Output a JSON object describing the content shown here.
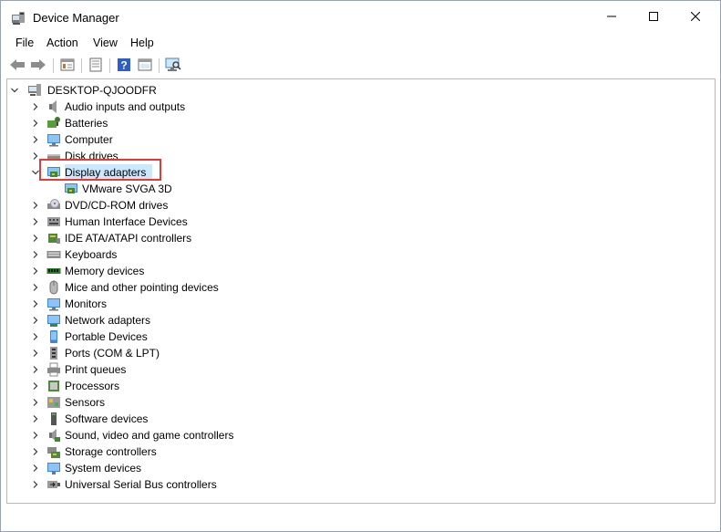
{
  "window": {
    "title": "Device Manager",
    "icon": "device-manager-icon"
  },
  "menu": [
    {
      "label": "File",
      "name": "menu-file"
    },
    {
      "label": "Action",
      "name": "menu-action"
    },
    {
      "label": "View",
      "name": "menu-view"
    },
    {
      "label": "Help",
      "name": "menu-help"
    }
  ],
  "toolbar": [
    "back-arrow-icon",
    "forward-arrow-icon",
    "console-tree-icon",
    "properties-icon",
    "help-icon",
    "view-icon",
    "scan-hardware-icon"
  ],
  "tree": {
    "root": {
      "label": "DESKTOP-QJOODFR",
      "icon": "computer-root-icon",
      "expanded": true
    },
    "categories": [
      {
        "label": "Audio inputs and outputs",
        "icon": "speaker-icon",
        "expanded": false
      },
      {
        "label": "Batteries",
        "icon": "battery-icon",
        "expanded": false
      },
      {
        "label": "Computer",
        "icon": "computer-icon",
        "expanded": false
      },
      {
        "label": "Disk drives",
        "icon": "disk-drive-icon",
        "expanded": false
      },
      {
        "label": "Display adapters",
        "icon": "display-adapter-icon",
        "expanded": true,
        "selected": true,
        "children": [
          {
            "label": "VMware SVGA 3D",
            "icon": "display-adapter-icon"
          }
        ]
      },
      {
        "label": "DVD/CD-ROM drives",
        "icon": "dvd-drive-icon",
        "expanded": false
      },
      {
        "label": "Human Interface Devices",
        "icon": "hid-icon",
        "expanded": false
      },
      {
        "label": "IDE ATA/ATAPI controllers",
        "icon": "ide-controller-icon",
        "expanded": false
      },
      {
        "label": "Keyboards",
        "icon": "keyboard-icon",
        "expanded": false
      },
      {
        "label": "Memory devices",
        "icon": "memory-icon",
        "expanded": false
      },
      {
        "label": "Mice and other pointing devices",
        "icon": "mouse-icon",
        "expanded": false
      },
      {
        "label": "Monitors",
        "icon": "monitor-icon",
        "expanded": false
      },
      {
        "label": "Network adapters",
        "icon": "network-adapter-icon",
        "expanded": false
      },
      {
        "label": "Portable Devices",
        "icon": "portable-device-icon",
        "expanded": false
      },
      {
        "label": "Ports (COM & LPT)",
        "icon": "port-icon",
        "expanded": false
      },
      {
        "label": "Print queues",
        "icon": "printer-icon",
        "expanded": false
      },
      {
        "label": "Processors",
        "icon": "processor-icon",
        "expanded": false
      },
      {
        "label": "Sensors",
        "icon": "sensor-icon",
        "expanded": false
      },
      {
        "label": "Software devices",
        "icon": "software-device-icon",
        "expanded": false
      },
      {
        "label": "Sound, video and game controllers",
        "icon": "sound-icon",
        "expanded": false
      },
      {
        "label": "Storage controllers",
        "icon": "storage-controller-icon",
        "expanded": false
      },
      {
        "label": "System devices",
        "icon": "system-device-icon",
        "expanded": false
      },
      {
        "label": "Universal Serial Bus controllers",
        "icon": "usb-icon",
        "expanded": false
      }
    ]
  },
  "colors": {
    "selection": "#cce8ff",
    "highlight_border": "#e53935",
    "accent": "#0078d7"
  }
}
